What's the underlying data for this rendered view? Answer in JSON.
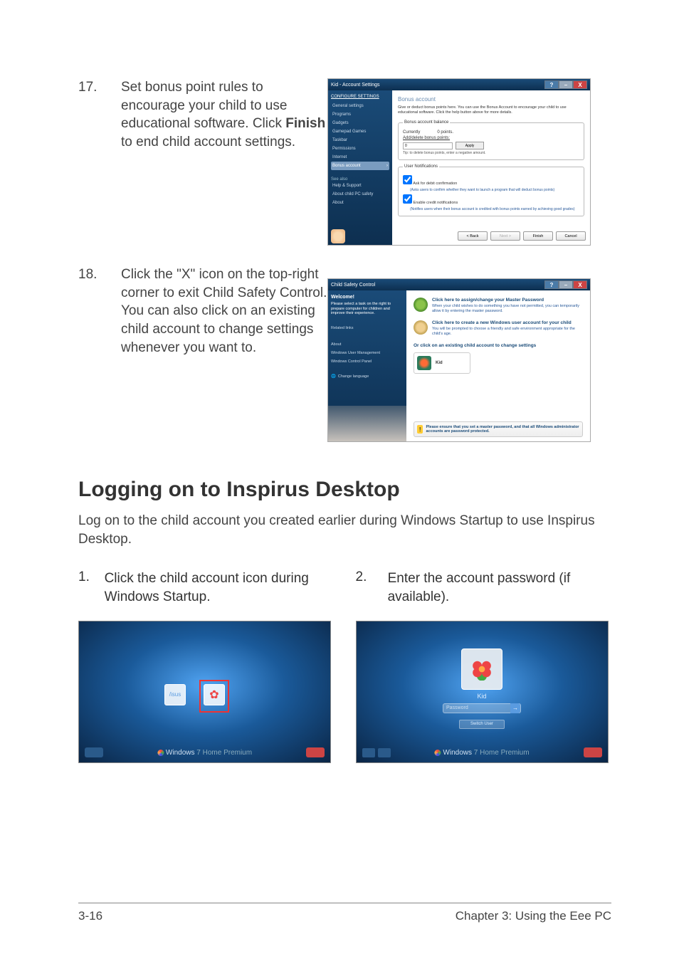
{
  "step17": {
    "num": "17.",
    "text_before": "Set bonus point rules to encourage your child to use educational software. Click ",
    "bold": "Finish",
    "text_after": " to end child account settings."
  },
  "step18": {
    "num": "18.",
    "text": "Click the \"X\" icon on the top-right corner to exit Child Safety Control. You can also click on an existing child account to change settings whenever you want to."
  },
  "ss1": {
    "title": "Kid - Account Settings",
    "help": "?",
    "min": "–",
    "close": "X",
    "sb_header": "CONFIGURE SETTINGS",
    "sb_items": [
      "General settings",
      "Programs",
      "Gadgets",
      "Gamepad Games",
      "Taskbar",
      "Permissions",
      "Internet",
      "Bonus account"
    ],
    "see_also": "See also",
    "see_items": [
      "Help & Support",
      "About child PC safety",
      "About"
    ],
    "h1": "Bonus account",
    "desc": "Give or deduct bonus points here. You can use the Bonus Account to encourage your child to use educational software. Click the help button above for more details.",
    "balance_legend": "Bonus account balance",
    "currently": "Currently",
    "points_val": "0 points.",
    "add_label": "Add/delete bonus points:",
    "input_val": "0",
    "apply": "Apply",
    "tip": "Tip: to delete bonus points, enter a negative amount.",
    "notif_legend": "User Notifications",
    "cb1": "Ask for debit confirmation",
    "cb1_note": "(Asks users to confirm whether they want to launch a program that will deduct bonus points)",
    "cb2": "Enable credit notifications",
    "cb2_note": "(Notifies users when their bonus account is credited with bonus points earned by achieving good grades)",
    "back": "< Back",
    "next": "Next >",
    "finish": "Finish",
    "cancel": "Cancel"
  },
  "ss2": {
    "title": "Child Safety Control",
    "help": "?",
    "min": "–",
    "close": "X",
    "welcome": "Welcome!",
    "intro": "Please select a task on the right to prepare computer for children and improve their experience.",
    "related": "Related links",
    "related_items": [
      "About",
      "Windows User Management",
      "Windows Control Panel"
    ],
    "change_lang": "Change language",
    "card1_title": "Click here to assign/change your Master Password",
    "card1_desc": "When your child wishes to do something you have not permitted, you can temporarily allow it by entering the master password.",
    "card2_title": "Click here to create a new Windows user account for your child",
    "card2_desc": "You will be prompted to choose a friendly and safe environment appropriate for the child's age.",
    "or_line": "Or click on an existing child account to change settings",
    "kid_name": "Kid",
    "warn_icon": "!",
    "warn_text": "Please ensure that you set a master password, and that all Windows administrator accounts are password protected."
  },
  "section": {
    "title": "Logging on to Inspirus Desktop",
    "desc": "Log on to the child account you created earlier during Windows Startup to use Inspirus Desktop."
  },
  "stepA": {
    "num": "1.",
    "text": "Click the child account icon during Windows Startup."
  },
  "stepB": {
    "num": "2.",
    "text": "Enter the account password (if available)."
  },
  "login": {
    "brand_prefix": "Windows",
    "brand_suffix": "7 Home Premium",
    "kid": "Kid",
    "password": "Password",
    "switch": "Switch User"
  },
  "footer": {
    "left": "3-16",
    "right": "Chapter 3: Using the Eee PC"
  }
}
